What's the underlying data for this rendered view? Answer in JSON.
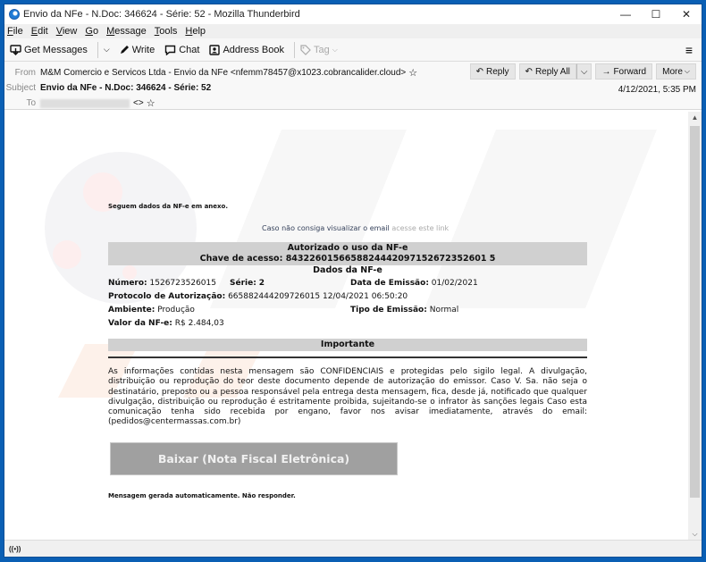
{
  "window": {
    "title": "Envio da NFe - N.Doc: 346624 - Série: 52 - Mozilla Thunderbird",
    "controls": {
      "minimize": "—",
      "maximize": "☐",
      "close": "✕"
    }
  },
  "menubar": {
    "items": [
      {
        "label": "File",
        "accel": "F",
        "rest": "ile"
      },
      {
        "label": "Edit",
        "accel": "E",
        "rest": "dit"
      },
      {
        "label": "View",
        "accel": "V",
        "rest": "iew"
      },
      {
        "label": "Go",
        "accel": "G",
        "rest": "o"
      },
      {
        "label": "Message",
        "accel": "M",
        "rest": "essage"
      },
      {
        "label": "Tools",
        "accel": "T",
        "rest": "ools"
      },
      {
        "label": "Help",
        "accel": "H",
        "rest": "elp"
      }
    ]
  },
  "toolbar": {
    "get_messages": "Get Messages",
    "write": "Write",
    "chat": "Chat",
    "address_book": "Address Book",
    "tag": "Tag"
  },
  "header": {
    "from_label": "From",
    "from_value": "M&M Comercio e Servicos Ltda - Envio da NFe <nfemm78457@x1023.cobrancalider.cloud>",
    "subject_label": "Subject",
    "subject_value": "Envio da NFe - N.Doc: 346624 - Série: 52",
    "to_label": "To",
    "to_suffix": "<>",
    "date": "4/12/2021, 5:35 PM",
    "actions": {
      "reply": "Reply",
      "reply_all": "Reply All",
      "forward": "Forward",
      "more": "More"
    }
  },
  "message": {
    "greeting": "Seguem dados da NF-e em anexo.",
    "view_prefix": "Caso não consiga visualizar o email",
    "view_link": "acesse este link",
    "auth_title": "Autorizado o uso da NF-e",
    "access_key": "Chave de acesso: 8432260156658824442097152672352601 5",
    "dados_title": "Dados da NF-e",
    "numero_label": "Número:",
    "numero_value": "1526723526015",
    "serie_label": "Série:",
    "serie_value": "2",
    "data_emissao_label": "Data de Emissão:",
    "data_emissao_value": "01/02/2021",
    "protocolo_label": "Protocolo de Autorização:",
    "protocolo_value": "665882444209726015 12/04/2021 06:50:20",
    "ambiente_label": "Ambiente:",
    "ambiente_value": "Produção",
    "tipo_label": "Tipo de Emissão:",
    "tipo_value": "Normal",
    "valor_label": "Valor da NF-e:",
    "valor_value": "R$ 2.484,03",
    "importante": "Importante",
    "legal_text": "As informações contidas nesta mensagem são CONFIDENCIAIS e protegidas pelo sigilo legal. A divulgação, distribuição ou reprodução do teor deste documento depende de autorização do emissor. Caso V. Sa. não seja o destinatário, preposto ou a pessoa responsável pela entrega desta mensagem, fica, desde já, notificado que qualquer divulgação, distribuição ou reprodução é estritamente proibida, sujeitando-se o infrator às sanções legais Caso esta comunicação tenha sido recebida por engano, favor nos avisar imediatamente, através do email: (pedidos@centermassas.com.br)",
    "download_button": "Baixar (Nota Fiscal Eletrônica)",
    "footer_note": "Mensagem gerada automaticamente. Não responder."
  },
  "statusbar": {
    "icon": "((•))"
  }
}
